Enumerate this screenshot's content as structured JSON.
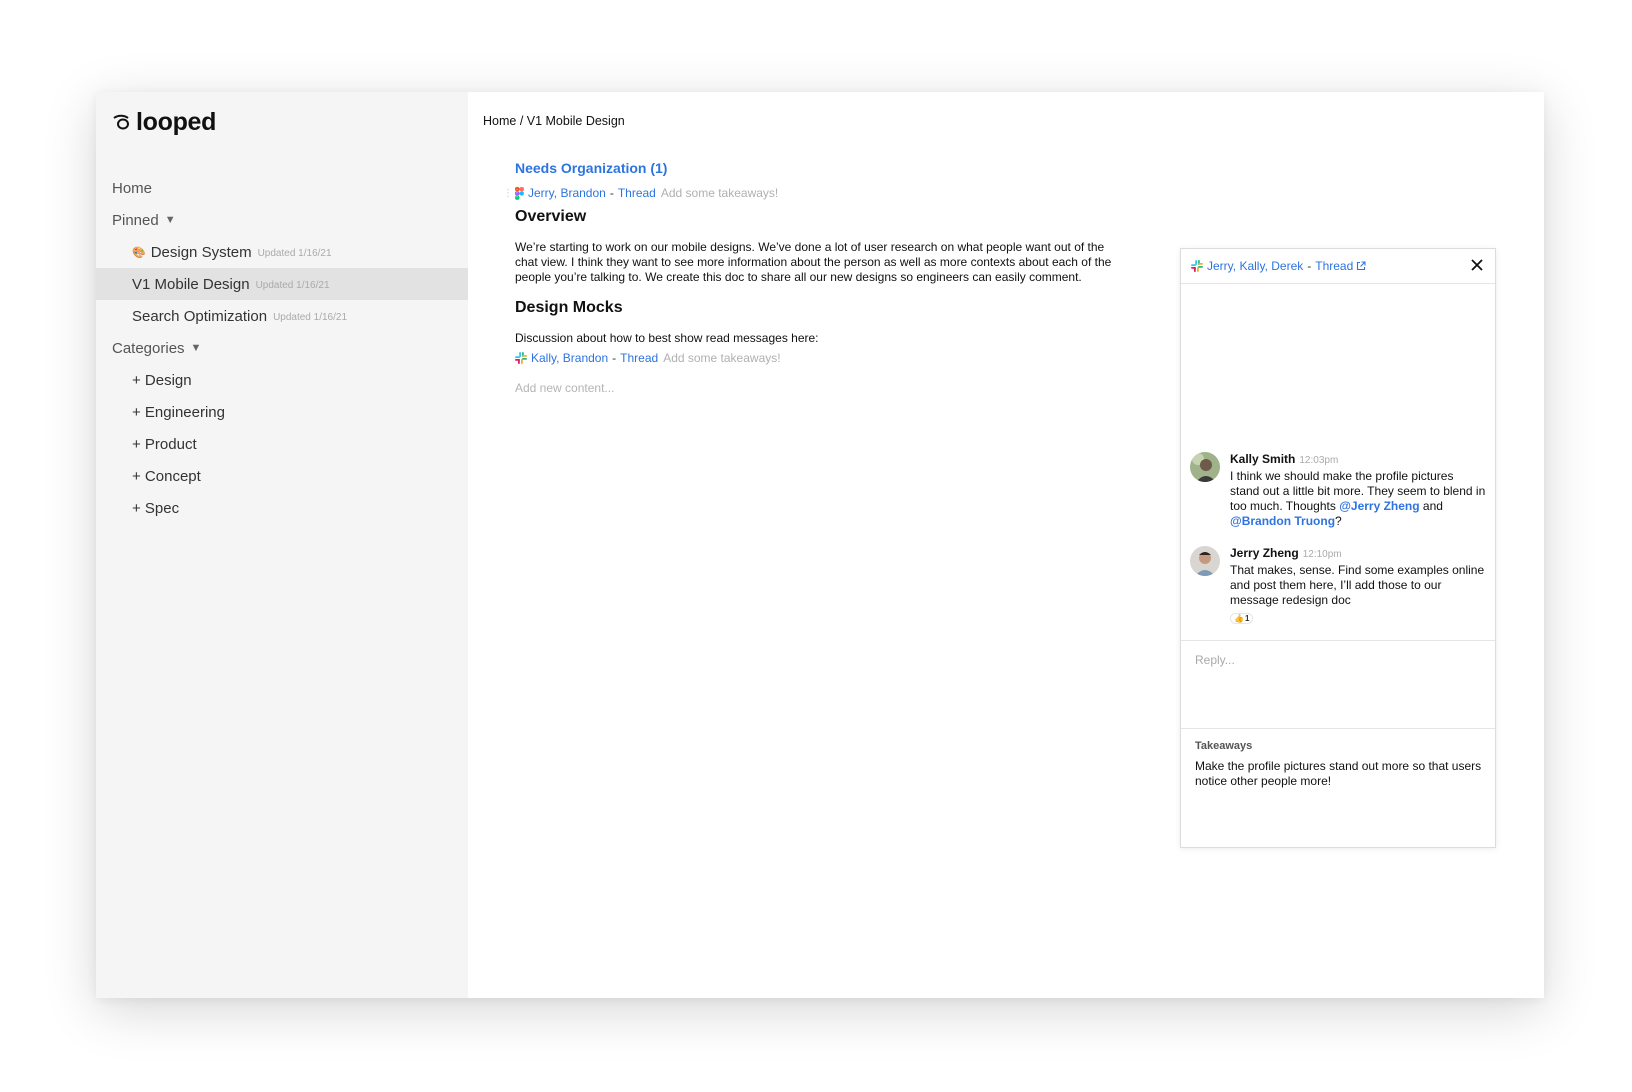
{
  "app": {
    "logo_text": "looped"
  },
  "sidebar": {
    "home": "Home",
    "pinned_label": "Pinned",
    "pinned": [
      {
        "label": "Design System",
        "updated": "Updated 1/16/21",
        "icon": "palette-icon"
      },
      {
        "label": "V1 Mobile Design",
        "updated": "Updated 1/16/21"
      },
      {
        "label": "Search Optimization",
        "updated": "Updated 1/16/21"
      }
    ],
    "categories_label": "Categories",
    "categories": [
      "+ Design",
      "+ Engineering",
      "+ Product",
      "+ Concept",
      "+ Spec"
    ]
  },
  "breadcrumb": "Home / V1 Mobile Design",
  "doc": {
    "needs_org": "Needs Organization (1)",
    "ref1": {
      "names": "Jerry, Brandon",
      "sep": "-",
      "thread": "Thread",
      "takeaways": "Add some takeaways!",
      "icon": "figma-icon"
    },
    "overview_title": "Overview",
    "overview_text": "We’re starting to work on our mobile designs. We’ve done a lot of user research on what people want out of the chat view. I think they want to see more information about the person as well as more contexts about each of the people you’re talking to. We create this doc to share all our new designs so engineers can easily comment.",
    "mocks_title": "Design Mocks",
    "mocks_text": "Discussion about how to best show read messages here:",
    "ref2": {
      "names": "Kally, Brandon",
      "sep": "-",
      "thread": "Thread",
      "takeaways": "Add some takeaways!",
      "icon": "slack-icon"
    },
    "add_new": "Add new content..."
  },
  "panel": {
    "names": "Jerry, Kally, Derek",
    "sep": "-",
    "thread": "Thread",
    "messages": [
      {
        "author": "Kally Smith",
        "time": "12:03pm",
        "text_before": "I think we should make the profile pictures stand out a little bit more. They seem to blend in too much. Thoughts ",
        "mention1": "@Jerry Zheng",
        "and": " and ",
        "mention2": "@Brandon Truong",
        "after": "?"
      },
      {
        "author": "Jerry Zheng",
        "time": "12:10pm",
        "text": "That makes, sense. Find some examples online and post them here, I’ll add those to our message redesign doc",
        "reaction_emoji": "👍",
        "reaction_count": "1"
      }
    ],
    "reply_placeholder": "Reply...",
    "takeaways_title": "Takeaways",
    "takeaways_text": "Make the profile pictures stand out more so that users notice other people more!"
  },
  "colors": {
    "link": "#2d74e0",
    "sidebar_bg": "#f5f5f5",
    "active_bg": "#e2e2e2"
  }
}
